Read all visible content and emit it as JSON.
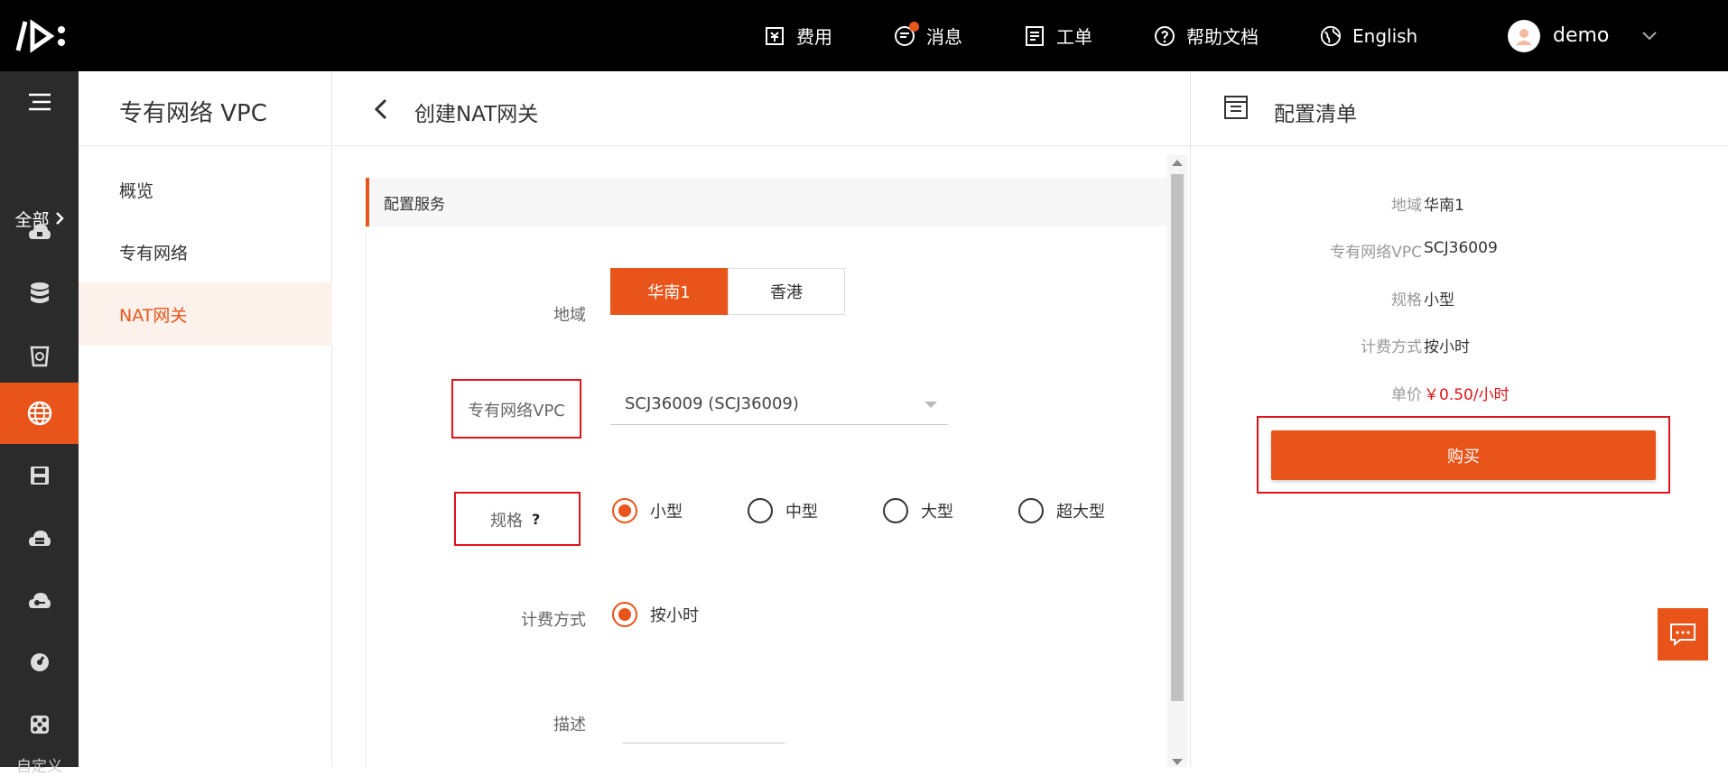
{
  "colors": {
    "accent": "#e8541a",
    "highlight_box": "#e0131a",
    "topbar": "#000000",
    "sidebar": "#2b2b2b"
  },
  "topbar": {
    "nav": [
      {
        "label": "费用",
        "icon": "billing-icon"
      },
      {
        "label": "消息",
        "icon": "message-icon"
      },
      {
        "label": "工单",
        "icon": "ticket-icon"
      },
      {
        "label": "帮助文档",
        "icon": "help-icon"
      },
      {
        "label": "English",
        "icon": "globe-icon"
      }
    ],
    "user": "demo"
  },
  "leftbar": {
    "all_label": "全部",
    "bottom_label": "自定义"
  },
  "subnav": {
    "title": "专有网络 VPC",
    "items": [
      "概览",
      "专有网络",
      "NAT网关"
    ]
  },
  "main": {
    "title": "创建NAT网关",
    "section": "配置服务",
    "form": {
      "region_label": "地域",
      "regions": [
        "华南1",
        "香港"
      ],
      "vpc_label": "专有网络VPC",
      "vpc_value": "SCJ36009 (SCJ36009)",
      "spec_label": "规格",
      "spec_help": "?",
      "spec_options": [
        "小型",
        "中型",
        "大型",
        "超大型"
      ],
      "billing_label": "计费方式",
      "billing_option": "按小时",
      "desc_label": "描述"
    }
  },
  "summary": {
    "title": "配置清单",
    "rows": [
      {
        "key": "地域",
        "value": "华南1"
      },
      {
        "key": "专有网络VPC",
        "value": "SCJ36009"
      },
      {
        "key": "规格",
        "value": "小型"
      },
      {
        "key": "计费方式",
        "value": "按小时"
      },
      {
        "key": "单价",
        "value": "￥0.50/小时"
      }
    ],
    "buy_label": "购买"
  }
}
